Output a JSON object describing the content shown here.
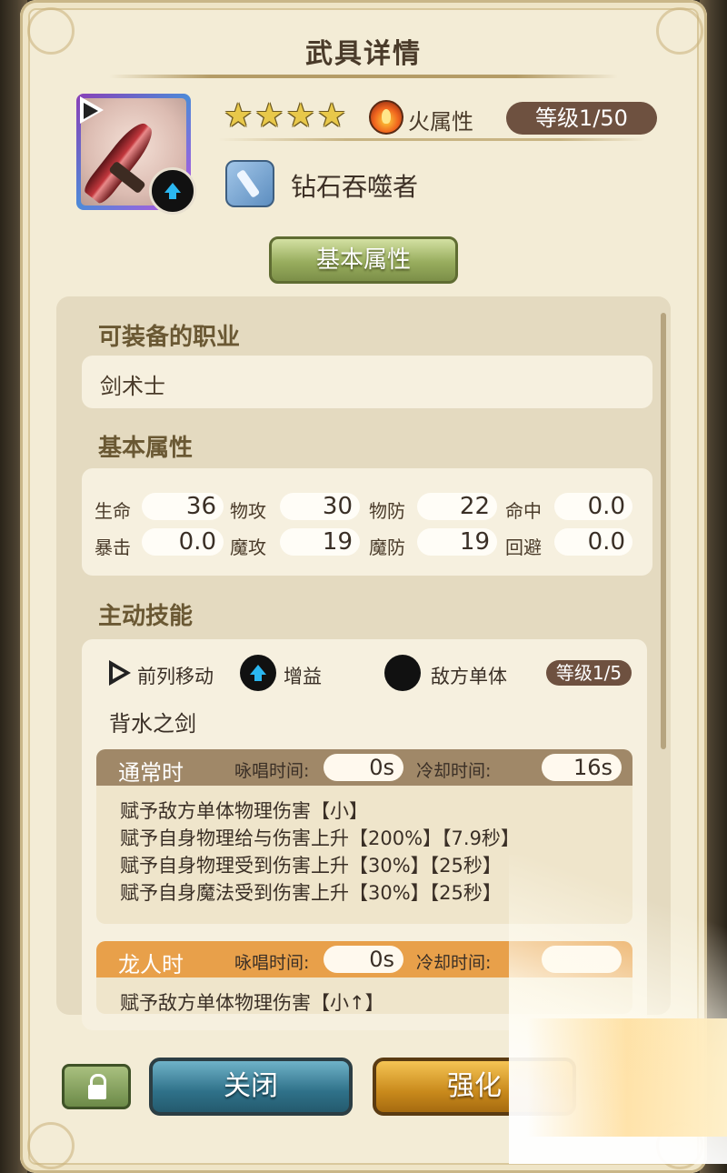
{
  "dialog": {
    "title": "武具详情"
  },
  "weapon": {
    "rarity_stars": 4,
    "element_icon": "fire-icon",
    "element_label": "火属性",
    "level_label": "等级1/50",
    "type_icon": "sword-icon",
    "name": "钻石吞噬者"
  },
  "tabs": {
    "basic": "基本属性"
  },
  "sections": {
    "jobs_title": "可装备的职业",
    "jobs_value": "剑术士",
    "stats_title": "基本属性",
    "skill_title": "主动技能"
  },
  "stats": [
    {
      "label": "生命",
      "value": "36"
    },
    {
      "label": "物攻",
      "value": "30"
    },
    {
      "label": "物防",
      "value": "22"
    },
    {
      "label": "命中",
      "value": "0.0"
    },
    {
      "label": "暴击",
      "value": "0.0"
    },
    {
      "label": "魔攻",
      "value": "19"
    },
    {
      "label": "魔防",
      "value": "19"
    },
    {
      "label": "回避",
      "value": "0.0"
    }
  ],
  "skill": {
    "tags": [
      "前列移动",
      "增益",
      "敌方单体"
    ],
    "level_label": "等级1/5",
    "name": "背水之剑",
    "normal": {
      "title": "通常时",
      "cast_label": "咏唱时间:",
      "cast_value": "0s",
      "cd_label": "冷却时间:",
      "cd_value": "16s",
      "effects": [
        "赋予敌方单体物理伤害【小】",
        "赋予自身物理给与伤害上升【200%】【7.9秒】",
        "赋予自身物理受到伤害上升【30%】【25秒】",
        "赋予自身魔法受到伤害上升【30%】【25秒】"
      ]
    },
    "dragon": {
      "title": "龙人时",
      "cast_label": "咏唱时间:",
      "cast_value": "0s",
      "cd_label": "冷却时间:",
      "effects": [
        "赋予敌方单体物理伤害【小↑】"
      ]
    }
  },
  "buttons": {
    "close": "关闭",
    "enhance": "强化"
  },
  "colors": {
    "normal_header": "#a08868",
    "dragon_header": "#e8a04a",
    "level_pill": "#6e5140"
  }
}
